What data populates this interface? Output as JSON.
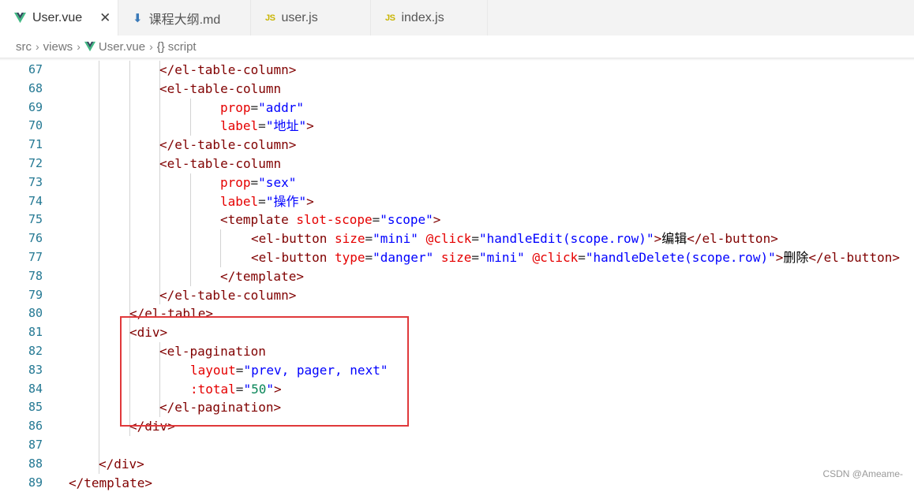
{
  "tabs": [
    {
      "label": "User.vue",
      "icon": "vue-icon",
      "active": true,
      "closable": true
    },
    {
      "label": "课程大纲.md",
      "icon": "markdown-icon",
      "active": false
    },
    {
      "label": "user.js",
      "icon": "js-icon",
      "active": false
    },
    {
      "label": "index.js",
      "icon": "js-icon",
      "active": false
    }
  ],
  "tab_js_badge": "JS",
  "tab_close_glyph": "✕",
  "breadcrumb": {
    "items": [
      "src",
      "views",
      "User.vue",
      "script"
    ],
    "symbol_glyph": "{}",
    "sep_glyph": "›"
  },
  "code_lines": [
    {
      "n": "67",
      "tokens": [
        [
          "tag",
          "</el-table-column>"
        ]
      ]
    },
    {
      "n": "68",
      "tokens": [
        [
          "tag",
          "<el-table-column"
        ]
      ]
    },
    {
      "n": "69",
      "tokens": [
        [
          "attr",
          "prop"
        ],
        [
          "punc",
          "="
        ],
        [
          "str",
          "\"addr\""
        ]
      ]
    },
    {
      "n": "70",
      "tokens": [
        [
          "attr",
          "label"
        ],
        [
          "punc",
          "="
        ],
        [
          "str",
          "\"地址\""
        ],
        [
          "tag",
          ">"
        ]
      ]
    },
    {
      "n": "71",
      "tokens": [
        [
          "tag",
          "</el-table-column>"
        ]
      ]
    },
    {
      "n": "72",
      "tokens": [
        [
          "tag",
          "<el-table-column"
        ]
      ]
    },
    {
      "n": "73",
      "tokens": [
        [
          "attr",
          "prop"
        ],
        [
          "punc",
          "="
        ],
        [
          "str",
          "\"sex\""
        ]
      ]
    },
    {
      "n": "74",
      "tokens": [
        [
          "attr",
          "label"
        ],
        [
          "punc",
          "="
        ],
        [
          "str",
          "\"操作\""
        ],
        [
          "tag",
          ">"
        ]
      ]
    },
    {
      "n": "75",
      "tokens": [
        [
          "tag",
          "<template "
        ],
        [
          "attr",
          "slot-scope"
        ],
        [
          "punc",
          "="
        ],
        [
          "str",
          "\"scope\""
        ],
        [
          "tag",
          ">"
        ]
      ]
    },
    {
      "n": "76",
      "tokens": [
        [
          "tag",
          "<el-button "
        ],
        [
          "attr",
          "size"
        ],
        [
          "punc",
          "="
        ],
        [
          "str",
          "\"mini\""
        ],
        [
          "plain",
          " "
        ],
        [
          "attr",
          "@click"
        ],
        [
          "punc",
          "="
        ],
        [
          "str",
          "\"handleEdit(scope.row)\""
        ],
        [
          "tag",
          ">"
        ],
        [
          "plain",
          "编辑"
        ],
        [
          "tag",
          "</el-button>"
        ]
      ]
    },
    {
      "n": "77",
      "tokens": [
        [
          "tag",
          "<el-button "
        ],
        [
          "attr",
          "type"
        ],
        [
          "punc",
          "="
        ],
        [
          "str",
          "\"danger\""
        ],
        [
          "plain",
          " "
        ],
        [
          "attr",
          "size"
        ],
        [
          "punc",
          "="
        ],
        [
          "str",
          "\"mini\""
        ],
        [
          "plain",
          " "
        ],
        [
          "attr",
          "@click"
        ],
        [
          "punc",
          "="
        ],
        [
          "str",
          "\"handleDelete(scope.row)\""
        ],
        [
          "tag",
          ">"
        ],
        [
          "plain",
          "删除"
        ],
        [
          "tag",
          "</el-button>"
        ]
      ]
    },
    {
      "n": "78",
      "tokens": [
        [
          "tag",
          "</template>"
        ]
      ]
    },
    {
      "n": "79",
      "tokens": [
        [
          "tag",
          "</el-table-column>"
        ]
      ]
    },
    {
      "n": "80",
      "tokens": [
        [
          "tag",
          "</el-table>"
        ]
      ]
    },
    {
      "n": "81",
      "tokens": [
        [
          "tag",
          "<div>"
        ]
      ]
    },
    {
      "n": "82",
      "tokens": [
        [
          "tag",
          "<el-pagination"
        ]
      ]
    },
    {
      "n": "83",
      "tokens": [
        [
          "attr",
          "layout"
        ],
        [
          "punc",
          "="
        ],
        [
          "str",
          "\"prev, pager, next\""
        ]
      ]
    },
    {
      "n": "84",
      "tokens": [
        [
          "attr",
          ":total"
        ],
        [
          "punc",
          "="
        ],
        [
          "str",
          "\""
        ],
        [
          "num",
          "50"
        ],
        [
          "str",
          "\""
        ],
        [
          "tag",
          ">"
        ]
      ]
    },
    {
      "n": "85",
      "tokens": [
        [
          "tag",
          "</el-pagination>"
        ]
      ]
    },
    {
      "n": "86",
      "tokens": [
        [
          "tag",
          "</div>"
        ]
      ]
    },
    {
      "n": "87",
      "tokens": []
    },
    {
      "n": "88",
      "tokens": [
        [
          "tag",
          "</div>"
        ]
      ]
    },
    {
      "n": "89",
      "tokens": [
        [
          "tag",
          "</template>"
        ]
      ]
    }
  ],
  "highlight_box_color": "#e0393b",
  "watermark": "CSDN @Ameame-",
  "colors": {
    "tag": "#800000",
    "attribute": "#e50000",
    "string": "#0000ff",
    "number": "#098658",
    "line_number": "#237893",
    "vue_logo": "#41b883"
  }
}
